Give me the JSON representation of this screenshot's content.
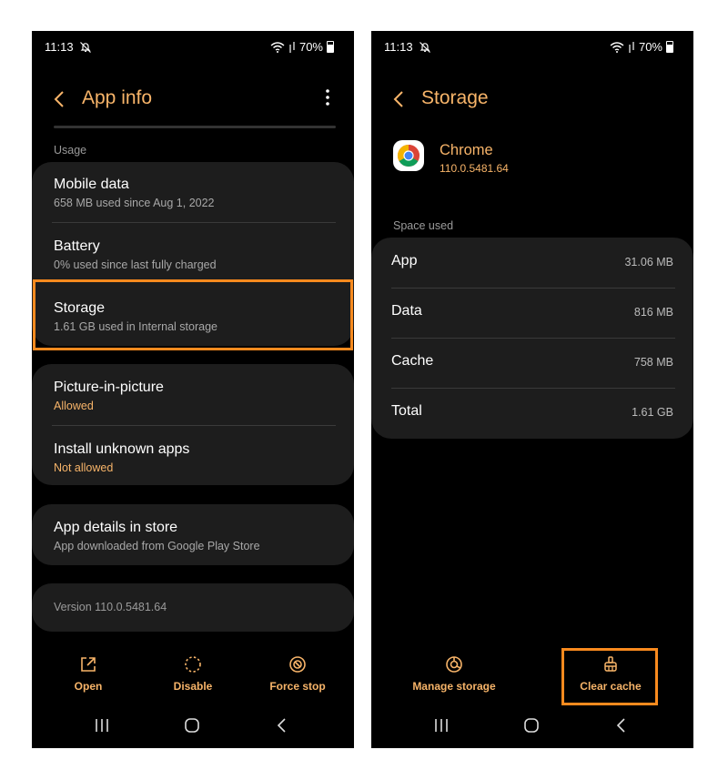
{
  "left": {
    "status": {
      "time": "11:13",
      "battery": "70%"
    },
    "title": "App info",
    "usage_label": "Usage",
    "usage_items": [
      {
        "title": "Mobile data",
        "subtitle": "658 MB used since Aug 1, 2022"
      },
      {
        "title": "Battery",
        "subtitle": "0% used since last fully charged"
      },
      {
        "title": "Storage",
        "subtitle": "1.61 GB used in Internal storage"
      }
    ],
    "permission_items": [
      {
        "title": "Picture-in-picture",
        "subtitle": "Allowed"
      },
      {
        "title": "Install unknown apps",
        "subtitle": "Not allowed"
      }
    ],
    "store_item": {
      "title": "App details in store",
      "subtitle": "App downloaded from Google Play Store"
    },
    "version": "Version 110.0.5481.64",
    "actions": {
      "open": "Open",
      "disable": "Disable",
      "force_stop": "Force stop"
    }
  },
  "right": {
    "status": {
      "time": "11:13",
      "battery": "70%"
    },
    "title": "Storage",
    "app_name": "Chrome",
    "app_version": "110.0.5481.64",
    "space_used_label": "Space used",
    "rows": [
      {
        "label": "App",
        "value": "31.06 MB"
      },
      {
        "label": "Data",
        "value": "816 MB"
      },
      {
        "label": "Cache",
        "value": "758 MB"
      },
      {
        "label": "Total",
        "value": "1.61 GB"
      }
    ],
    "actions": {
      "manage_storage": "Manage storage",
      "clear_cache": "Clear cache"
    }
  },
  "colors": {
    "accent": "#f7b469",
    "highlight": "#f98a1e",
    "card": "#1d1d1d",
    "background": "#000000"
  },
  "icons": [
    "mute-icon",
    "wifi-icon",
    "battery-icon",
    "back-arrow-icon",
    "more-options-icon",
    "open-icon",
    "disable-icon",
    "force-stop-icon",
    "manage-storage-icon",
    "clear-cache-icon",
    "recents-icon",
    "home-icon",
    "nav-back-icon",
    "chrome-logo"
  ]
}
